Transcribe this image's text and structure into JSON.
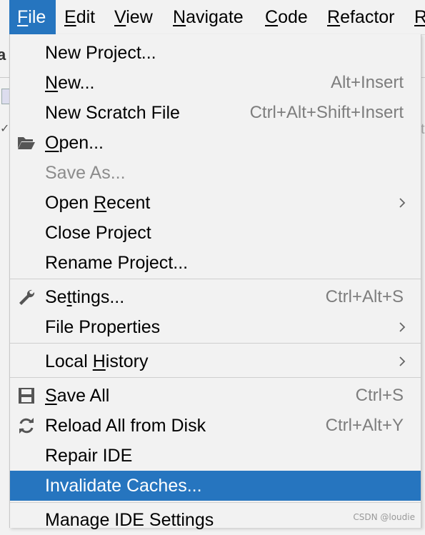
{
  "menubar": {
    "items": [
      {
        "mnemonic": "F",
        "rest": "ile",
        "active": true
      },
      {
        "mnemonic": "E",
        "rest": "dit"
      },
      {
        "mnemonic": "V",
        "rest": "iew"
      },
      {
        "mnemonic": "N",
        "rest": "avigate"
      },
      {
        "mnemonic": "C",
        "rest": "ode"
      },
      {
        "mnemonic": "R",
        "rest": "efactor"
      },
      {
        "mnemonic": "R",
        "rest": ""
      }
    ]
  },
  "file_menu": {
    "new_project": "New Project...",
    "new": {
      "pre": "",
      "mn": "N",
      "post": "ew...",
      "shortcut": "Alt+Insert"
    },
    "new_scratch": {
      "label": "New Scratch File",
      "shortcut": "Ctrl+Alt+Shift+Insert"
    },
    "open": {
      "pre": "",
      "mn": "O",
      "post": "pen...",
      "icon": "folder-open-icon"
    },
    "save_as": "Save As...",
    "open_recent": {
      "pre": "Open ",
      "mn": "R",
      "post": "ecent"
    },
    "close_project": {
      "pre": "Close Pro",
      "mn": "j",
      "post": "ect"
    },
    "rename_project": "Rename Project...",
    "settings": {
      "pre": "Se",
      "mn": "t",
      "post": "tings...",
      "shortcut": "Ctrl+Alt+S",
      "icon": "wrench-icon"
    },
    "file_properties": "File Properties",
    "local_history": {
      "pre": "Local ",
      "mn": "H",
      "post": "istory"
    },
    "save_all": {
      "pre": "",
      "mn": "S",
      "post": "ave All",
      "shortcut": "Ctrl+S",
      "icon": "save-icon"
    },
    "reload": {
      "label": "Reload All from Disk",
      "shortcut": "Ctrl+Alt+Y",
      "icon": "reload-icon"
    },
    "repair_ide": "Repair IDE",
    "invalidate_caches": "Invalidate Caches...",
    "manage_ide_settings": "Manage IDE Settings"
  },
  "watermark": "CSDN @loudie",
  "colors": {
    "highlight": "#2675bf",
    "background": "#f2f2f2",
    "shortcut": "#7d7d7d",
    "disabled": "#8c8c8c"
  }
}
